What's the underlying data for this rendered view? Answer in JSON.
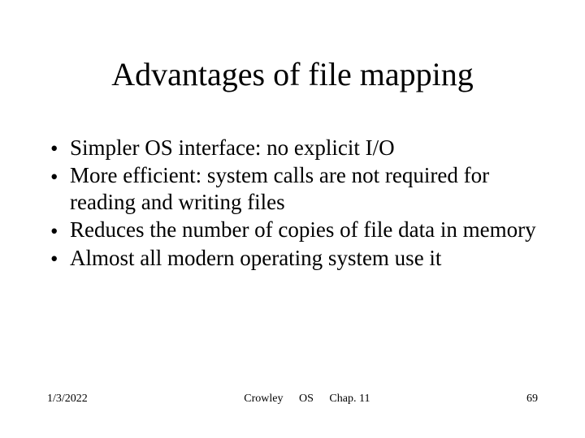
{
  "title": "Advantages of file mapping",
  "bullets": [
    "Simpler OS interface: no explicit I/O",
    "More efficient: system calls are not required for reading and writing files",
    "Reduces the number of copies of file data in memory",
    "Almost all modern operating system use it"
  ],
  "footer": {
    "date": "1/3/2022",
    "author": "Crowley",
    "course": "OS",
    "chapter": "Chap. 11",
    "page": "69"
  }
}
